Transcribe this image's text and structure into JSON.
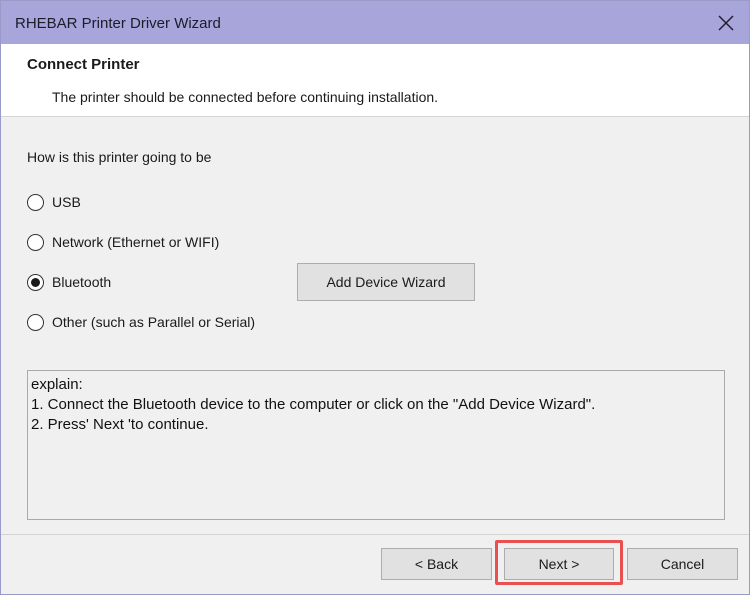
{
  "window": {
    "title": "RHEBAR Printer Driver Wizard",
    "close_icon": "close-icon"
  },
  "header": {
    "title": "Connect Printer",
    "subtitle": "The printer should be connected before continuing installation."
  },
  "question": "How is this printer going to be",
  "options": [
    {
      "label": "USB",
      "selected": false
    },
    {
      "label": "Network (Ethernet or WIFI)",
      "selected": false
    },
    {
      "label": "Bluetooth",
      "selected": true
    },
    {
      "label": "Other (such as Parallel or Serial)",
      "selected": false
    }
  ],
  "add_device_button": "Add Device Wizard",
  "explain_text": "explain:\n1. Connect the Bluetooth device to the computer or click on the \"Add Device Wizard\".\n2. Press' Next 'to continue.",
  "footer": {
    "back_label": "< Back",
    "next_label": "Next >",
    "cancel_label": "Cancel"
  },
  "colors": {
    "titlebar": "#a7a5da",
    "highlight": "#e8514f"
  }
}
